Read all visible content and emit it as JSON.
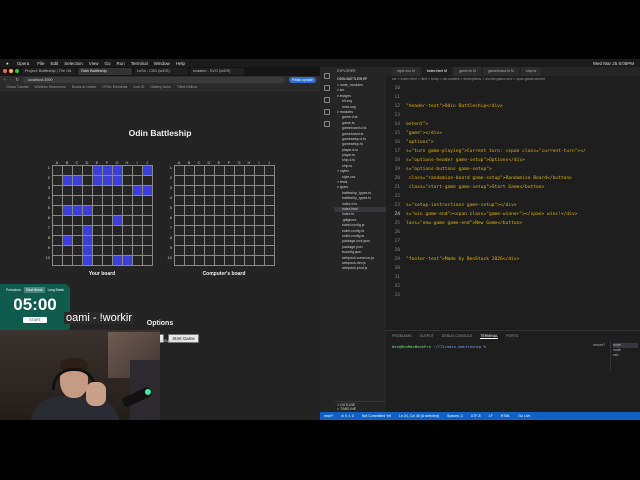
{
  "menubar": {
    "apple": "",
    "app": "Opera",
    "items": [
      "File",
      "Edit",
      "Selection",
      "View",
      "Go",
      "Run",
      "Terminal",
      "Window",
      "Help"
    ],
    "clock": "Wed Mar 25 8:05PM"
  },
  "browser": {
    "tabs": [
      {
        "label": "Project: Battleship | The Od"
      },
      {
        "label": "Odin Battleship"
      },
      {
        "label": "LeSn - C5G (w/DS)"
      },
      {
        "label": "ecdaton - SVG (w/DS)"
      }
    ],
    "url": "localhost:3000",
    "update_label": "Finish update",
    "bookmarks": [
      "Chess Tutorial",
      "Wikilinkz Resources",
      "Books at reader",
      "HTML Elements",
      "Icon ID",
      "Gallery Icons",
      "Tilted Helbox"
    ]
  },
  "game": {
    "title": "Odin Battleship",
    "columns": [
      "A",
      "B",
      "C",
      "D",
      "E",
      "F",
      "G",
      "H",
      "I",
      "J"
    ],
    "rows": [
      "1",
      "2",
      "3",
      "4",
      "5",
      "6",
      "7",
      "8",
      "9",
      "10"
    ],
    "your_board_label": "Your board",
    "computer_board_label": "Computer's board",
    "your_ships": [
      [
        0,
        4
      ],
      [
        0,
        5
      ],
      [
        0,
        6
      ],
      [
        0,
        9
      ],
      [
        1,
        1
      ],
      [
        1,
        2
      ],
      [
        1,
        4
      ],
      [
        1,
        5
      ],
      [
        1,
        6
      ],
      [
        2,
        8
      ],
      [
        2,
        9
      ],
      [
        4,
        1
      ],
      [
        4,
        2
      ],
      [
        4,
        3
      ],
      [
        5,
        6
      ],
      [
        6,
        3
      ],
      [
        7,
        1
      ],
      [
        7,
        3
      ],
      [
        8,
        3
      ],
      [
        9,
        3
      ],
      [
        9,
        6
      ],
      [
        9,
        7
      ]
    ],
    "options_title": "Options",
    "randomize_label": "Randomize Board",
    "start_label": "Start Game"
  },
  "timer": {
    "modes": [
      "Pomodoro",
      "Short Break",
      "Long Break"
    ],
    "time": "05:00",
    "start_label": "START"
  },
  "stream": {
    "caption": "oami - !workir",
    "made_by": "enStack 2026"
  },
  "vscode": {
    "explorer_header": "EXPLORER",
    "project_name": "ODIN-BATTLESHIP",
    "files": [
      "> node_modules",
      "v src",
      "v images",
      "hit.svg",
      "miss.svg",
      "v modules",
      "game.d.ts",
      "game.ts",
      "gameboard.d.ts",
      "gameboard.ts",
      "gamesetup.d.ts",
      "gamesetup.ts",
      "player.d.ts",
      "player.ts",
      "ship.d.ts",
      "ship.ts",
      "> styles",
      "style.css",
      "> tests",
      "v types",
      "battleship_types.ts",
      "battleship_types.tx",
      "index.d.ts",
      "index.html",
      "index.ts",
      ".gitignore",
      "babel.config.js",
      "eslint.config.ts",
      "eslint.config.ts",
      "package-lock.json",
      "package.json",
      "tsconfig.json",
      "webpack.common.js",
      "webpack.dev.js",
      "webpack.prod.js"
    ],
    "selected_file": "index.html",
    "outline": "> OUTLINE",
    "timeline": "> TIMELINE",
    "tabs": [
      "style.css M",
      "index.html M",
      "game.ts M",
      "gameboard.ts M",
      "ship.ts"
    ],
    "active_tab": "index.html M",
    "breadcrumb": "src > index.html > html > body > div.content > div#options > div.win.game-end > span.game-winner",
    "lines": [
      {
        "n": "10",
        "t": ""
      },
      {
        "n": "11",
        "t": ""
      },
      {
        "n": "12",
        "t": "\"header-text\">Odin Battleship</div>"
      },
      {
        "n": "13",
        "t": ""
      },
      {
        "n": "14",
        "t": "ontent\">"
      },
      {
        "n": "15",
        "t": "\"game\"></div>"
      },
      {
        "n": "16",
        "t": "\"options\">"
      },
      {
        "n": "17",
        "t": "s=\"turn game-playing\">Current turn: <span class=\"current-turn\"></"
      },
      {
        "n": "18",
        "t": "s=\"options-header game-setup\">Options</div>"
      },
      {
        "n": "19",
        "t": "s=\"options-buttons game-setup\">"
      },
      {
        "n": "20",
        "t": " class=\"randomize-board game-setup\">Randomize Board</button>"
      },
      {
        "n": "21",
        "t": " class=\"start-game game-setup\">Start Game</button>"
      },
      {
        "n": "22",
        "t": ""
      },
      {
        "n": "23",
        "t": "s=\"setup-instructions game-setup\"></div>"
      },
      {
        "n": "24",
        "t": "s=\"win game-end\"><span class=\"game-winner\"></span> wins!</div>"
      },
      {
        "n": "25",
        "t": "lass=\"new-game game-end\">New Game</button>"
      },
      {
        "n": "26",
        "t": ""
      },
      {
        "n": "27",
        "t": ""
      },
      {
        "n": "28",
        "t": ""
      },
      {
        "n": "29",
        "t": "\"footer-text\">Made by BenStack 2026</div>"
      },
      {
        "n": "30",
        "t": ""
      },
      {
        "n": "31",
        "t": ""
      },
      {
        "n": "32",
        "t": ""
      },
      {
        "n": "33",
        "t": ""
      }
    ],
    "current_line": "24",
    "panel_tabs": [
      "PROBLEMS",
      "OUTPUT",
      "DEBUG CONSOLE",
      "TERMINAL",
      "PORTS"
    ],
    "active_panel_tab": "TERMINAL",
    "terminal_user": "ben@BenMacBookPro",
    "terminal_path": "~/TT2/odin-battleship",
    "terminal_prompt": "%",
    "panel_right_label": "mscm?",
    "terminal_list": [
      "node",
      "node",
      "zsh"
    ],
    "status_items": [
      "main*",
      "⊘ 0 ⚠ 0",
      "Not Committed Yet",
      "Ln 24, Col 48 (6 selected)",
      "Spaces: 2",
      "UTF-8",
      "LF",
      "HTML",
      "Go Live"
    ]
  },
  "colors": {
    "ship": "#3b3fd8",
    "timer_bg": "#0f5c4e",
    "statusbar": "#0f62c5",
    "code_text": "#e6b400"
  }
}
